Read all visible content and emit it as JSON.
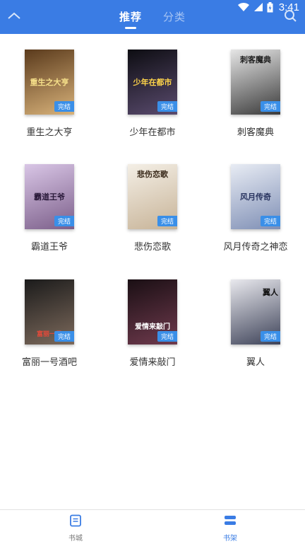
{
  "status": {
    "time": "3:41"
  },
  "header": {
    "tabs": [
      {
        "label": "推荐",
        "active": true
      },
      {
        "label": "分类",
        "active": false
      }
    ]
  },
  "books": [
    {
      "title": "重生之大亨",
      "cover_text": "重生之大亨",
      "badge": "完结",
      "cover_colors": [
        "#5a3a1c",
        "#d8b27a"
      ]
    },
    {
      "title": "少年在都市",
      "cover_text": "少年在都市",
      "badge": "完结",
      "cover_colors": [
        "#0d0d12",
        "#5a4b6e"
      ]
    },
    {
      "title": "刺客魔典",
      "cover_text": "刺客魔典",
      "badge": "完结",
      "cover_colors": [
        "#e6e6e6",
        "#3a3a3a"
      ]
    },
    {
      "title": "霸道王爷",
      "cover_text": "霸道王爷",
      "badge": "完结",
      "cover_colors": [
        "#d9c6e6",
        "#7c5f8a"
      ]
    },
    {
      "title": "悲伤恋歌",
      "cover_text": "悲伤恋歌",
      "badge": "完结",
      "cover_colors": [
        "#f4efe6",
        "#c7b397"
      ]
    },
    {
      "title": "风月传奇之神恋",
      "cover_text": "风月传奇",
      "badge": "完结",
      "cover_colors": [
        "#e8ecf4",
        "#7f8fb5"
      ]
    },
    {
      "title": "富丽一号酒吧",
      "cover_text": "富丽一号",
      "badge": "完结",
      "cover_colors": [
        "#1b1b1b",
        "#7d6a5c"
      ]
    },
    {
      "title": "爱情来敲门",
      "cover_text": "爱情来敲门",
      "badge": "完结",
      "cover_colors": [
        "#1a0f14",
        "#6f3a4d"
      ]
    },
    {
      "title": "翼人",
      "cover_text": "翼人",
      "badge": "完结",
      "cover_colors": [
        "#e9e9ee",
        "#3d4258"
      ]
    }
  ],
  "bottom_nav": [
    {
      "label": "书城",
      "icon": "book-store-icon",
      "active": false
    },
    {
      "label": "书架",
      "icon": "bookshelf-icon",
      "active": true
    }
  ],
  "colors": {
    "primary": "#3a7ce4",
    "badge": "#3a8fe8"
  }
}
